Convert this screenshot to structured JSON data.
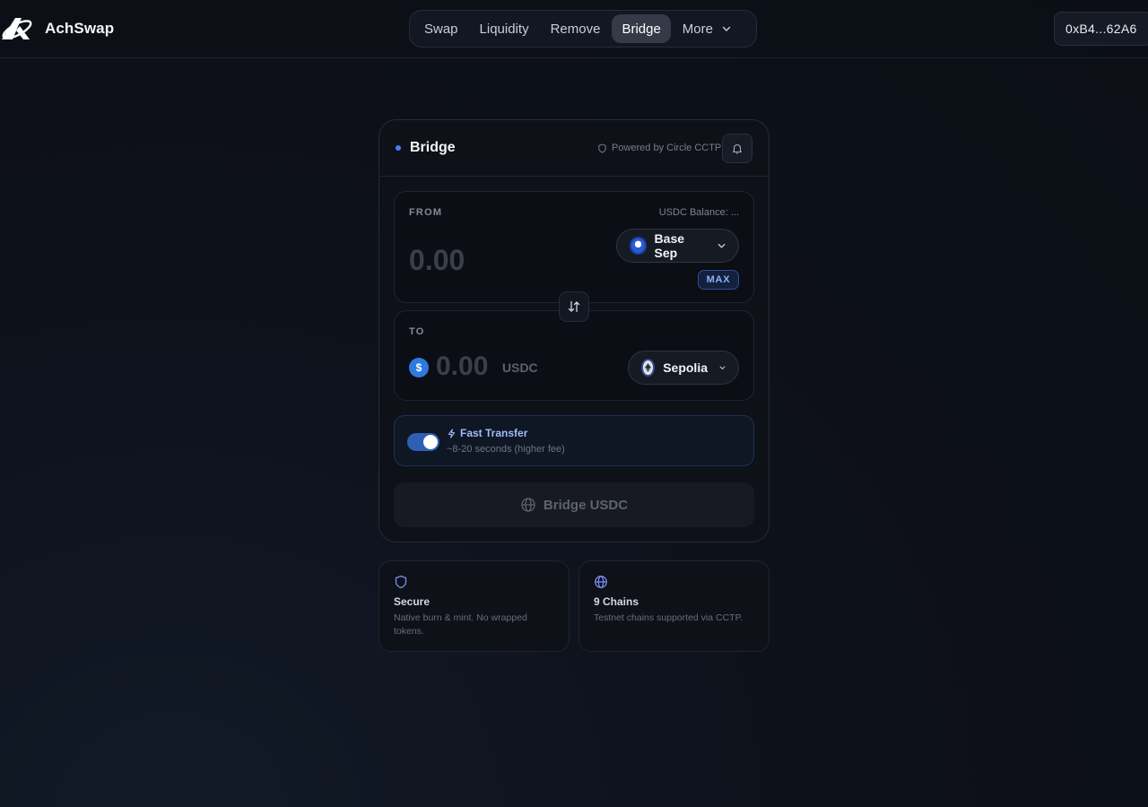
{
  "header": {
    "brand": "AchSwap",
    "nav": [
      {
        "label": "Swap"
      },
      {
        "label": "Liquidity"
      },
      {
        "label": "Remove"
      },
      {
        "label": "Bridge"
      },
      {
        "label": "More"
      }
    ],
    "wallet": "0xB4...62A6"
  },
  "bridge_card": {
    "title": "Bridge",
    "powered_by": "Powered by Circle CCTP",
    "from": {
      "label": "FROM",
      "balance": "USDC Balance: ...",
      "amount": "0.00",
      "chain": "Base Sep",
      "max_label": "MAX"
    },
    "to": {
      "label": "TO",
      "amount": "0.00",
      "unit": "USDC",
      "token_symbol": "$",
      "chain": "Sepolia"
    },
    "fast_transfer": {
      "title": "Fast Transfer",
      "subtitle": "~8-20 seconds (higher fee)",
      "enabled": true
    },
    "action_label": "Bridge USDC"
  },
  "info_cards": [
    {
      "title": "Secure",
      "desc": "Native burn & mint. No wrapped tokens."
    },
    {
      "title": "9 Chains",
      "desc": "Testnet chains supported via CCTP."
    }
  ],
  "colors": {
    "accent": "#4c7dff",
    "toggle_on": "#2f5fb5",
    "usdc": "#2f7ae0"
  }
}
